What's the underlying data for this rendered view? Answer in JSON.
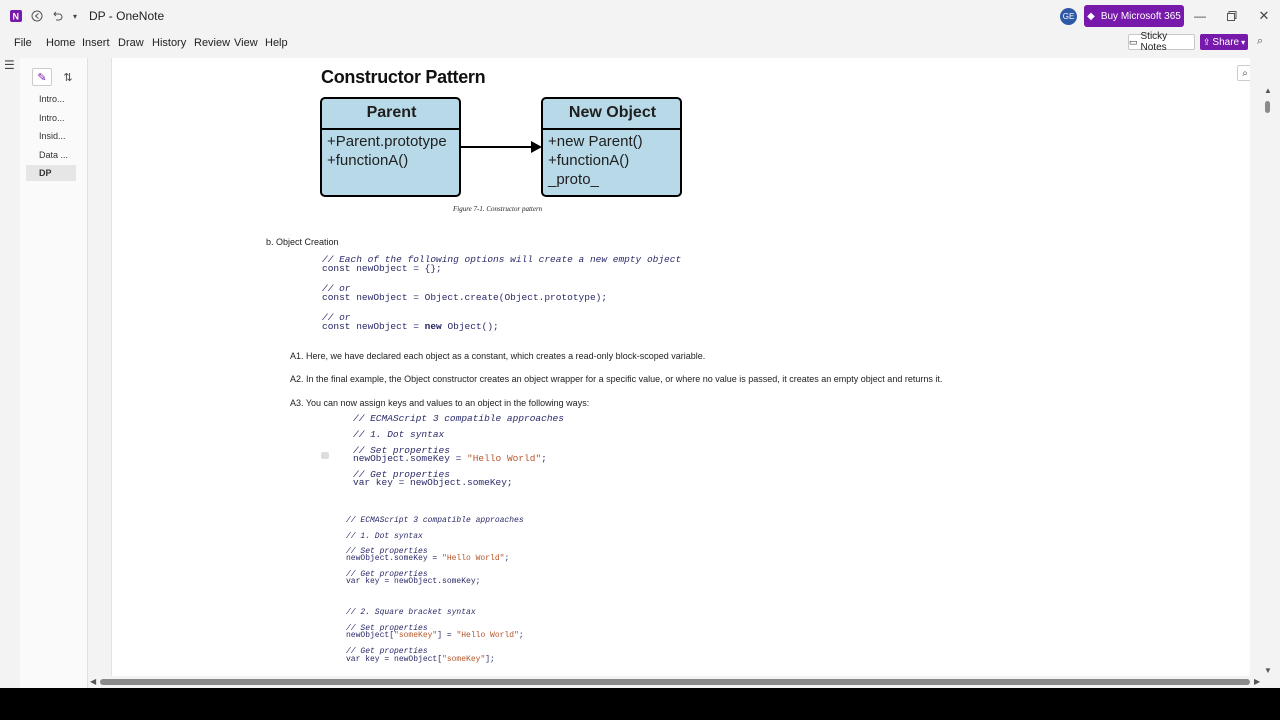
{
  "window": {
    "title": "DP - OneNote",
    "avatar_initials": "GE",
    "buy_label": "Buy Microsoft 365",
    "accent": "#7719aa"
  },
  "menu": [
    "File",
    "Home",
    "Insert",
    "Draw",
    "History",
    "Review",
    "View",
    "Help"
  ],
  "toolbar": {
    "sticky_notes": "Sticky Notes",
    "share": "Share"
  },
  "pages": [
    {
      "label": "Intro..."
    },
    {
      "label": "Intro..."
    },
    {
      "label": "Insid..."
    },
    {
      "label": "Data ..."
    },
    {
      "label": "DP",
      "selected": true
    }
  ],
  "note": {
    "heading": "Constructor Pattern",
    "diagram": {
      "left": {
        "title": "Parent",
        "lines": [
          "+Parent.prototype",
          "+functionA()"
        ]
      },
      "right": {
        "title": "New Object",
        "lines": [
          "+new Parent()",
          "+functionA()",
          "_proto_"
        ]
      },
      "caption": "Figure 7-1. Constructor pattern"
    },
    "section_b": "b. Object Creation",
    "code1": {
      "c1": "// Each of the following options will create a new empty object",
      "l1_kw": "const",
      "l1_rest": " newObject = {};",
      "c2": "// or",
      "l2_kw": "const",
      "l2_rest": " newObject = Object.create(Object.prototype);",
      "c3": "// or",
      "l3_kw": "const",
      "l3_a": " newObject = ",
      "l3_kw2": "new",
      "l3_b": " Object();"
    },
    "a1": "A1. Here, we have declared each object as a constant, which creates a read-only block-scoped variable.",
    "a2": "A2. In the final example, the Object constructor creates an object wrapper for a specific value, or where no value is passed, it creates an empty object and returns it.",
    "a3": "A3. You can now assign keys and values to an object in the following ways:",
    "code2": {
      "c1": "// ECMAScript 3 compatible approaches",
      "c2": "// 1. Dot syntax",
      "c3": "// Set properties",
      "l1_a": "newObject.someKey = ",
      "l1_str": "\"Hello World\"",
      "l1_b": ";",
      "c4": "// Get properties",
      "l2_kw": "var",
      "l2_rest": " key = newObject.someKey;"
    },
    "code3": {
      "c1": "// ECMAScript 3 compatible approaches",
      "c2": "// 1. Dot syntax",
      "c3": "// Set properties",
      "l1_a": "newObject.someKey = ",
      "l1_str": "\"Hello World\"",
      "l1_b": ";",
      "c4": "// Get properties",
      "l2_kw": "var",
      "l2_rest": " key = newObject.someKey;",
      "c5": "// 2. Square bracket syntax",
      "c6": "// Set properties",
      "l3_a": "newObject[",
      "l3_str": "\"someKey\"",
      "l3_b": "] = ",
      "l3_str2": "\"Hello World\"",
      "l3_c": ";",
      "c7": "// Get properties",
      "l4_kw": "var",
      "l4_a": " key = newObject[",
      "l4_str": "\"someKey\"",
      "l4_b": "];"
    }
  }
}
